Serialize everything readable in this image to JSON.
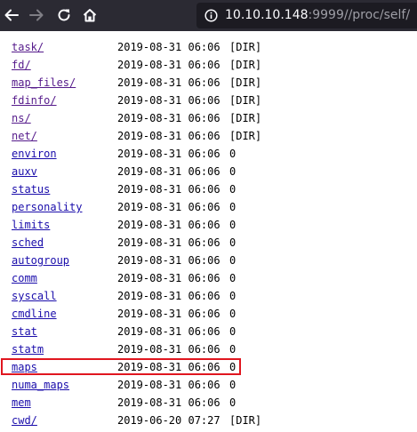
{
  "browser": {
    "url_host": "10.10.10.148",
    "url_rest": ":9999//proc/self/",
    "back_icon": "arrow-left-icon",
    "forward_icon": "arrow-right-icon",
    "reload_icon": "reload-icon",
    "home_icon": "home-icon",
    "info_icon": "info-icon"
  },
  "listing": {
    "entries": [
      {
        "name": "task/",
        "date": "2019-08-31 06:06",
        "size": "[DIR]"
      },
      {
        "name": "fd/",
        "date": "2019-08-31 06:06",
        "size": "[DIR]"
      },
      {
        "name": "map_files/",
        "date": "2019-08-31 06:06",
        "size": "[DIR]"
      },
      {
        "name": "fdinfo/",
        "date": "2019-08-31 06:06",
        "size": "[DIR]"
      },
      {
        "name": "ns/",
        "date": "2019-08-31 06:06",
        "size": "[DIR]"
      },
      {
        "name": "net/",
        "date": "2019-08-31 06:06",
        "size": "[DIR]"
      },
      {
        "name": "environ",
        "date": "2019-08-31 06:06",
        "size": "0"
      },
      {
        "name": "auxv",
        "date": "2019-08-31 06:06",
        "size": "0"
      },
      {
        "name": "status",
        "date": "2019-08-31 06:06",
        "size": "0"
      },
      {
        "name": "personality",
        "date": "2019-08-31 06:06",
        "size": "0"
      },
      {
        "name": "limits",
        "date": "2019-08-31 06:06",
        "size": "0"
      },
      {
        "name": "sched",
        "date": "2019-08-31 06:06",
        "size": "0"
      },
      {
        "name": "autogroup",
        "date": "2019-08-31 06:06",
        "size": "0"
      },
      {
        "name": "comm",
        "date": "2019-08-31 06:06",
        "size": "0"
      },
      {
        "name": "syscall",
        "date": "2019-08-31 06:06",
        "size": "0"
      },
      {
        "name": "cmdline",
        "date": "2019-08-31 06:06",
        "size": "0"
      },
      {
        "name": "stat",
        "date": "2019-08-31 06:06",
        "size": "0"
      },
      {
        "name": "statm",
        "date": "2019-08-31 06:06",
        "size": "0"
      },
      {
        "name": "maps",
        "date": "2019-08-31 06:06",
        "size": "0"
      },
      {
        "name": "numa_maps",
        "date": "2019-08-31 06:06",
        "size": "0"
      },
      {
        "name": "mem",
        "date": "2019-08-31 06:06",
        "size": "0"
      },
      {
        "name": "cwd/",
        "date": "2019-06-20 07:27",
        "size": "[DIR]"
      }
    ]
  },
  "colors": {
    "toolbar_bg": "#2b2a33",
    "link": "#1a0dab",
    "visited_link": "#551a8b",
    "highlight_border": "#e0161f"
  }
}
